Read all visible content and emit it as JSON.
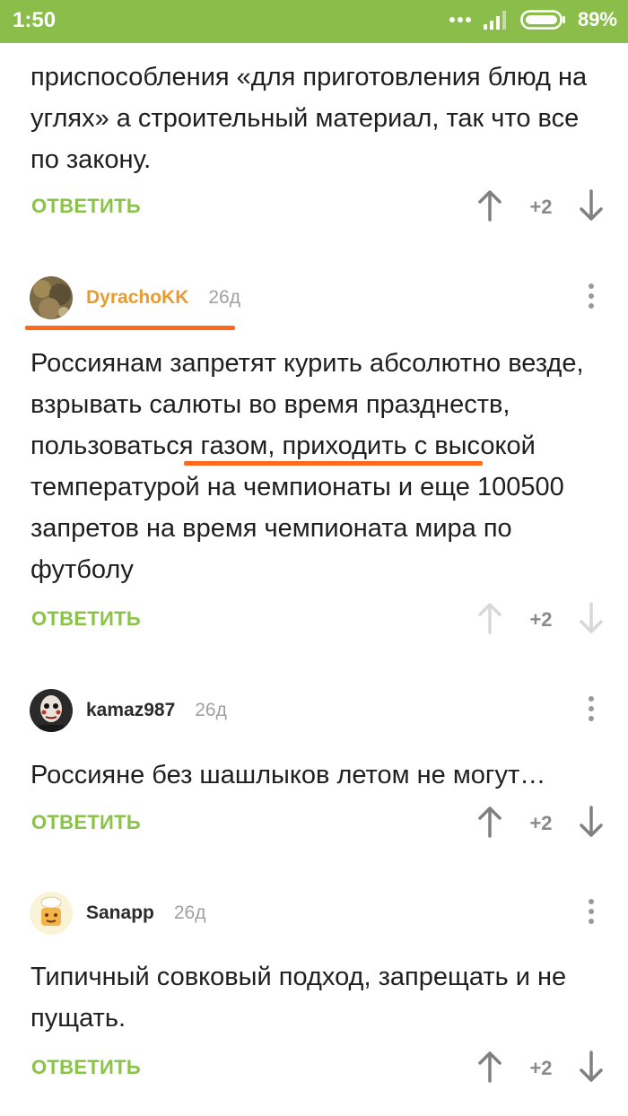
{
  "status_bar": {
    "time": "1:50",
    "battery": "89%",
    "dots": "...",
    "background": "#8bbd4a"
  },
  "colors": {
    "accent_green": "#8bc34a",
    "annotation_orange": "#ff6a1a",
    "username_highlight": "#e89b31"
  },
  "comments": [
    {
      "text": "приспособления «для приготовления блюд на углях» а строительный материал, так что все по закону.",
      "reply_label": "ОТВЕТИТЬ",
      "rating": "+2"
    },
    {
      "username": "DyrachoKK",
      "age": "26д",
      "text_before": "Россиянам запретят курить абсолютно везде, взрывать салюты во время празднеств,",
      "text_highlight": "пользоваться газом",
      "text_after": ", приходить с высокой температурой на чемпионаты и еще 100500 запретов на время чемпионата мира по футболу",
      "reply_label": "ОТВЕТИТЬ",
      "rating": "+2"
    },
    {
      "username": "kamaz987",
      "age": "26д",
      "text": "Россияне без шашлыков летом не могут…",
      "reply_label": "ОТВЕТИТЬ",
      "rating": "+2"
    },
    {
      "username": "Sanapp",
      "age": "26д",
      "text": "Типичный совковый подход, запрещать и не пущать.",
      "reply_label": "ОТВЕТИТЬ",
      "rating": "+2"
    }
  ]
}
